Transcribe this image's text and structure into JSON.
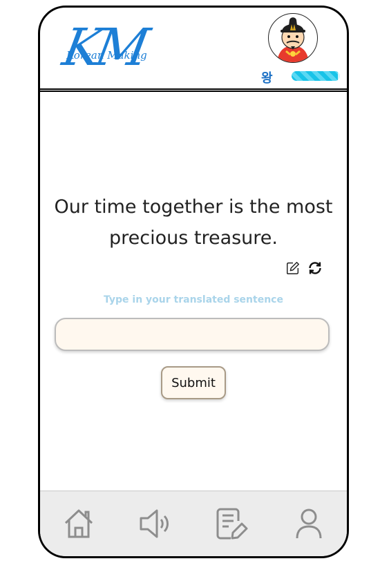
{
  "header": {
    "logo_text": "KM",
    "logo_subtitle": "Korean Making",
    "user_rank": "왕",
    "progress_fraction": 0.95
  },
  "exercise": {
    "sentence": "Our time together is the most precious treasure.",
    "instruction": "Type in your translated sentence",
    "answer_value": "",
    "submit_label": "Submit"
  },
  "icons": {
    "edit": "edit-icon",
    "refresh": "refresh-icon",
    "home": "home-icon",
    "sound": "speaker-icon",
    "quiz": "quiz-icon",
    "profile": "user-icon"
  },
  "colors": {
    "brand": "#1d7fd6",
    "rank": "#1a6fc4",
    "progress": "#18c3e8",
    "instruction": "#a9d4ea",
    "input_bg": "#fff8ef",
    "nav_bg": "#ececec"
  }
}
